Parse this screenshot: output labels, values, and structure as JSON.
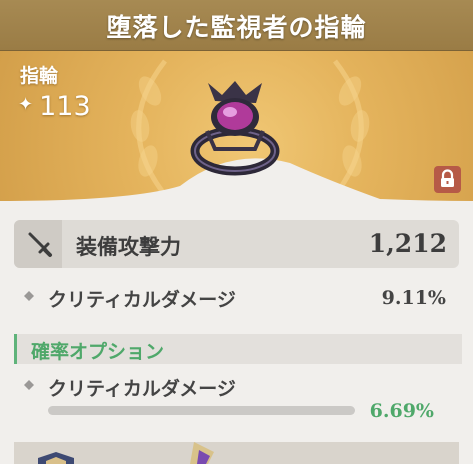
{
  "header": {
    "title": "堕落した監視者の指輪"
  },
  "banner": {
    "item_type": "指輪",
    "level": "113",
    "icons": {
      "level": "sparkle-icon",
      "lock": "lock-icon",
      "item": "ring-icon"
    }
  },
  "main_stat": {
    "name": "装備攻撃力",
    "value": "1,212",
    "icon": "sword-icon"
  },
  "sub_stat": {
    "name": "クリティカルダメージ",
    "value": "9.11%",
    "icon": "diamond-icon"
  },
  "probability_option": {
    "heading": "確率オプション",
    "name": "クリティカルダメージ",
    "value": "6.69%",
    "fill": 0.0,
    "color": "#4fa86a"
  },
  "colors": {
    "header": "#a78a53",
    "banner": "#e4b35c",
    "accent_green": "#4fa86a",
    "lock": "#b65a47"
  }
}
